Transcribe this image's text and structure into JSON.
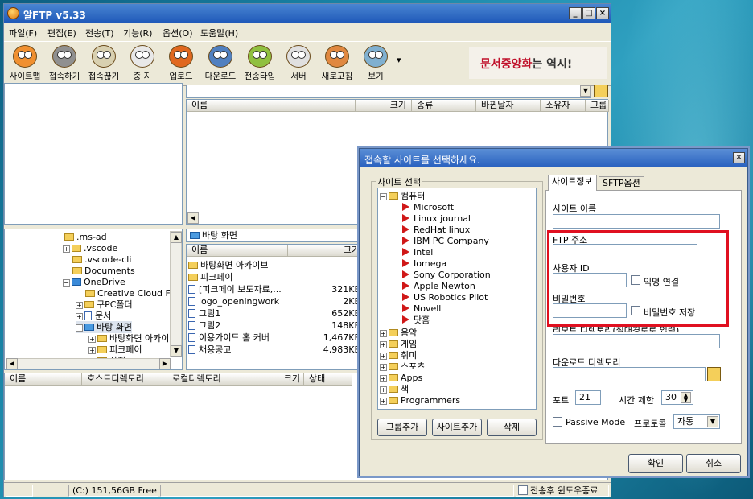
{
  "app": {
    "title": "알FTP v5.33"
  },
  "window_buttons": {
    "min": "_",
    "max": "□",
    "close": "×"
  },
  "menu": [
    "파일(F)",
    "편집(E)",
    "전송(T)",
    "기능(R)",
    "옵션(O)",
    "도움말(H)"
  ],
  "toolbar": [
    {
      "label": "사이트맵",
      "icon": "sitemap-icon",
      "color": "#f09030"
    },
    {
      "label": "접속하기",
      "icon": "connect-icon",
      "color": "#909090"
    },
    {
      "label": "접속끊기",
      "icon": "disconnect-icon",
      "color": "#d8d0b0"
    },
    {
      "label": "중 지",
      "icon": "stop-icon",
      "color": "#e8e8e8"
    },
    {
      "label": "업로드",
      "icon": "upload-icon",
      "color": "#e06820"
    },
    {
      "label": "다운로드",
      "icon": "download-icon",
      "color": "#5080c0"
    },
    {
      "label": "전송타입",
      "icon": "transfer-type-icon",
      "color": "#90c040"
    },
    {
      "label": "서버",
      "icon": "server-icon",
      "color": "#e0e0e0"
    },
    {
      "label": "새로고침",
      "icon": "refresh-icon",
      "color": "#e08840"
    },
    {
      "label": "보기",
      "icon": "view-icon",
      "color": "#80b0d0"
    }
  ],
  "toolbar_more": "▾",
  "banner": {
    "red": "문서중앙화",
    "dark": "는 역시!"
  },
  "remote_list": {
    "headers": [
      "이름",
      "크기",
      "종류",
      "바뀐날자",
      "소유자",
      "그룹"
    ]
  },
  "local_tree": [
    ".ms-ad",
    ".vscode",
    ".vscode-cli",
    "Documents",
    "OneDrive",
    "Creative Cloud Fi",
    "구PC폴더",
    "문서",
    "바탕 화면",
    "바탕화면 아카이",
    "피크페이",
    "사진"
  ],
  "local_path": "바탕 화면",
  "local_list": {
    "headers": [
      "이름",
      "크기"
    ],
    "rows": [
      {
        "name": "바탕화면 아카이브",
        "size": ""
      },
      {
        "name": "피크페이",
        "size": ""
      },
      {
        "name": "[피크페이 보도자료,...",
        "size": "321KB"
      },
      {
        "name": "logo_openingwork",
        "size": "2KB"
      },
      {
        "name": "그림1",
        "size": "652KB"
      },
      {
        "name": "그림2",
        "size": "148KB"
      },
      {
        "name": "이용가이드 홈 커버",
        "size": "1,467KB"
      },
      {
        "name": "채용공고",
        "size": "4,983KB"
      }
    ]
  },
  "queue": {
    "headers": [
      "이름",
      "호스트디렉토리",
      "로컬디렉토리",
      "크기",
      "상태"
    ]
  },
  "status": {
    "drive": "(C:)  151,56GB Free",
    "close_after": "전송후 윈도우종료"
  },
  "dialog": {
    "title": "접속할 사이트를 선택하세요.",
    "close": "×",
    "site_group_label": "사이트 선택",
    "tree": {
      "root": "컴퓨터",
      "children": [
        "Microsoft",
        "Linux journal",
        "RedHat linux",
        "IBM PC Company",
        "Intel",
        "Iomega",
        "Sony Corporation",
        "Apple Newton",
        "US Robotics Pilot",
        "Novell",
        "닷홈"
      ],
      "others": [
        "음악",
        "게임",
        "취미",
        "스포츠",
        "Apps",
        "책",
        "Programmers"
      ]
    },
    "buttons": {
      "add_group": "그룹추가",
      "add_site": "사이트추가",
      "delete": "삭제",
      "ok": "확인",
      "cancel": "취소"
    },
    "tabs": [
      "사이트정보",
      "SFTP옵션"
    ],
    "fields": {
      "site_name": "사이트 이름",
      "ftp_address": "FTP 주소",
      "user_id": "사용자 ID",
      "anonymous": "익명 연결",
      "password": "비밀번호",
      "save_password": "비밀번호 저장",
      "remote_dir": "리모트 디렉토리(절대경로로 입력)",
      "download_dir": "다운로드 디렉토리",
      "port_label": "포트",
      "port_value": "21",
      "timeout_label": "시간 제한",
      "timeout_value": "30",
      "passive": "Passive Mode",
      "protocol_label": "프로토콜",
      "protocol_value": "자동"
    }
  },
  "colors": {
    "highlight_box": "#e01020",
    "title_bar": "#2a62c0",
    "banner_red": "#c0102a"
  }
}
